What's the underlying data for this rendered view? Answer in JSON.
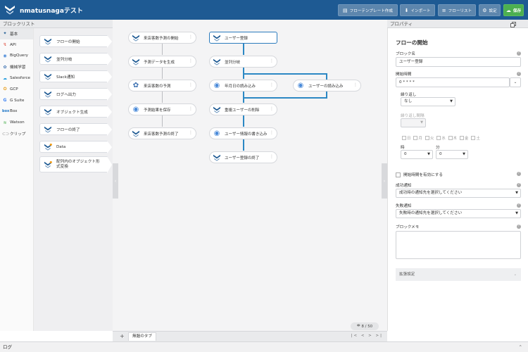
{
  "header": {
    "title": "nmatusnagaテスト",
    "buttons": [
      {
        "label": "フローテンプレート作成",
        "icon": "template-icon"
      },
      {
        "label": "インポート",
        "icon": "download-icon"
      },
      {
        "label": "フローリスト",
        "icon": "list-icon"
      },
      {
        "label": "設定",
        "icon": "gear-icon"
      },
      {
        "label": "保存",
        "icon": "save-icon"
      }
    ]
  },
  "left_panel": {
    "title": "ブロックリスト",
    "categories": [
      {
        "label": "基本",
        "icon": "basic-icon",
        "active": true
      },
      {
        "label": "API",
        "icon": "api-icon"
      },
      {
        "label": "BigQuery",
        "icon": "bigquery-icon"
      },
      {
        "label": "機械学習",
        "icon": "ml-icon"
      },
      {
        "label": "Salesforce",
        "icon": "salesforce-icon"
      },
      {
        "label": "GCP",
        "icon": "gcp-icon"
      },
      {
        "label": "G Suite",
        "icon": "gsuite-icon"
      },
      {
        "label": "Box",
        "icon": "box-icon"
      },
      {
        "label": "Watson",
        "icon": "watson-icon"
      },
      {
        "label": "クリップ",
        "icon": "clip-icon"
      }
    ],
    "blocks": [
      {
        "label": "フローの開始"
      },
      {
        "label": "並列分岐"
      },
      {
        "label": "Slack通知"
      },
      {
        "label": "ログへ出力"
      },
      {
        "label": "オブジェクト生成"
      },
      {
        "label": "フローの終了"
      },
      {
        "label": "Data"
      },
      {
        "label": "配列内のオブジェクト形式変換"
      }
    ]
  },
  "canvas": {
    "left_flow": [
      "来店客数予測の開始",
      "予測データを生成",
      "来店客数の予測",
      "予測結果を保存",
      "来店客数予測の終了"
    ],
    "right_flow": [
      "ユーザー登録",
      "並列分岐",
      "年月日の読み込み",
      "ユーザーの読み込み",
      "重複ユーザーの削除",
      "ユーザー情報の書き込み",
      "ユーザー登録の終了"
    ],
    "counter": "8 / 50",
    "tab_label": "無題のタブ",
    "tab_nav": "|< < > >|"
  },
  "properties": {
    "panel_title": "プロパティ",
    "block_title": "フローの開始",
    "block_name_label": "ブロック名",
    "block_name_value": "ユーザー登録",
    "start_time_label": "開始時間",
    "start_time_value": "0 * * * *",
    "repeat_label": "繰り返し",
    "repeat_value": "なし",
    "repeat_interval_label": "繰り返し間隔",
    "days": [
      "日",
      "月",
      "火",
      "水",
      "木",
      "金",
      "土"
    ],
    "hour_label": "時",
    "hour_value": "0",
    "minute_label": "分",
    "minute_value": "0",
    "enable_start_label": "開始時間を有効にする",
    "success_label": "成功通知",
    "success_value": "成功時の通知先を選択してください",
    "failure_label": "失敗通知",
    "failure_value": "失敗時の通知先を選択してください",
    "memo_label": "ブロックメモ",
    "extended_label": "拡張設定"
  },
  "log_label": "ログ"
}
